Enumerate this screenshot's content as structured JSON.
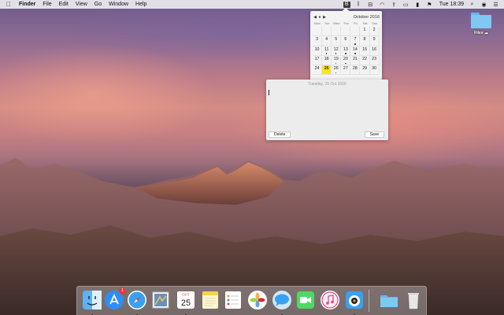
{
  "menubar": {
    "apple_icon": "apple-icon",
    "items": [
      "Finder",
      "File",
      "Edit",
      "View",
      "Go",
      "Window",
      "Help"
    ],
    "status_icons": [
      "calendar-app-icon",
      "bluetooth-icon",
      "vpn-icon",
      "wifi-icon",
      "upload-icon",
      "airplay-icon",
      "battery-icon",
      "flag-icon"
    ],
    "clock": "Tue 18:39",
    "right_icons": [
      "search-icon",
      "siri-icon",
      "notification-center-icon"
    ]
  },
  "desktop": {
    "folder_label": "Files ☁"
  },
  "calendar": {
    "month_label": "October 2016",
    "nav": [
      "◀",
      "●",
      "▶"
    ],
    "weekdays": [
      "Mon",
      "Tue",
      "Wed",
      "Thu",
      "Fri",
      "Sat",
      "Sun"
    ],
    "weeks": [
      [
        "",
        "",
        "",
        "",
        "",
        "1",
        "2"
      ],
      [
        "3",
        "4",
        "5",
        "6",
        "7",
        "8",
        "9"
      ],
      [
        "10",
        "11",
        "12",
        "13",
        "14",
        "15",
        "16"
      ],
      [
        "17",
        "18",
        "19",
        "20",
        "21",
        "22",
        "23"
      ],
      [
        "24",
        "25",
        "26",
        "27",
        "28",
        "29",
        "30"
      ]
    ],
    "today": "25",
    "event_days": [
      "7",
      "11",
      "12",
      "13",
      "14",
      "19",
      "20",
      "26"
    ]
  },
  "note": {
    "date_label": "Tuesday, 25 Oct 2016",
    "delete_label": "Delete",
    "save_label": "Save"
  },
  "dock": {
    "apps": [
      {
        "name": "finder-icon",
        "running": true
      },
      {
        "name": "app-store-icon",
        "running": false,
        "badge": "1"
      },
      {
        "name": "safari-icon",
        "running": true
      },
      {
        "name": "mail-icon",
        "running": false
      },
      {
        "name": "calendar-icon",
        "running": true,
        "month": "OCT",
        "day": "25"
      },
      {
        "name": "notes-icon",
        "running": false
      },
      {
        "name": "reminders-icon",
        "running": false
      },
      {
        "name": "photos-icon",
        "running": false
      },
      {
        "name": "messages-icon",
        "running": true
      },
      {
        "name": "facetime-icon",
        "running": false
      },
      {
        "name": "itunes-icon",
        "running": false
      },
      {
        "name": "tweetbot-icon",
        "running": true
      },
      {
        "name": "folder-icon",
        "running": false
      },
      {
        "name": "trash-icon",
        "running": false
      }
    ]
  },
  "colors": {
    "menubar_bg": "#ececee",
    "today_highlight": "#f8e71c",
    "badge_red": "#e53935"
  }
}
